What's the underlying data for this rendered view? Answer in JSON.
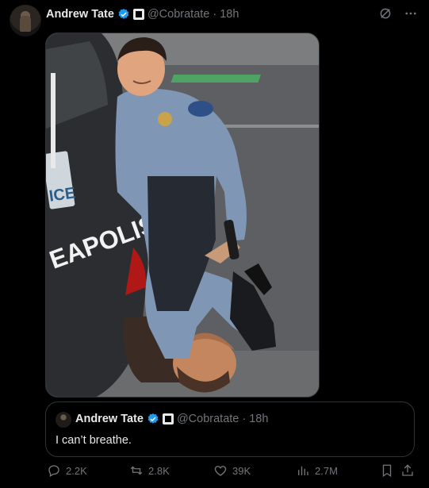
{
  "author": {
    "name": "Andrew Tate",
    "handle": "@Cobratate",
    "time": "· 18h"
  },
  "header_icons": [
    "grok-icon",
    "more-icon"
  ],
  "media": {
    "alt": "Edited photo of a police officer kneeling on a man beside a police car",
    "car_text": "EAPOLIS",
    "plate_text": "ICE"
  },
  "quoted": {
    "name": "Andrew Tate",
    "handle": "@Cobratate",
    "time": "· 18h",
    "text": "I can’t breathe."
  },
  "actions": {
    "replies": "2.2K",
    "reposts": "2.8K",
    "likes": "39K",
    "views": "2.7M"
  },
  "colors": {
    "background": "#000000",
    "text": "#e7e9ea",
    "muted": "#71767b",
    "verified": "#1d9bf0",
    "border": "#2f3336"
  }
}
